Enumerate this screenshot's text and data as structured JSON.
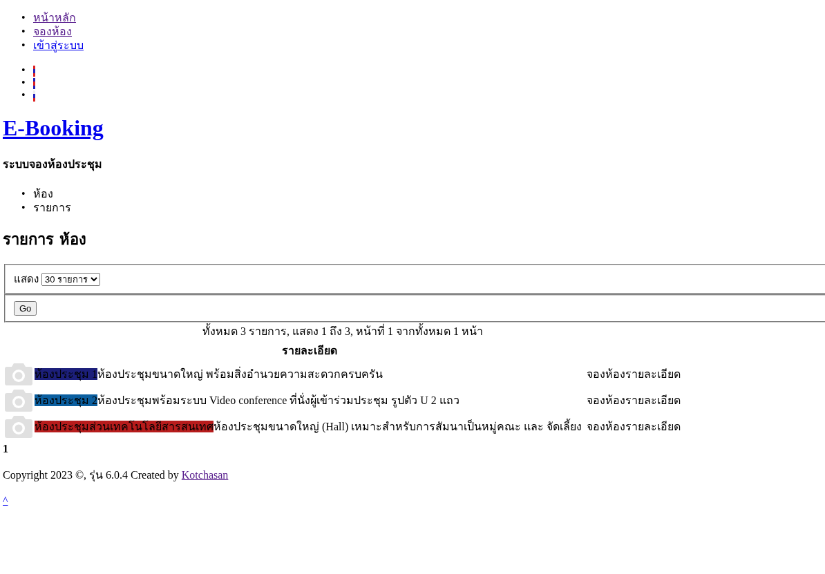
{
  "top_menu": [
    {
      "bullet": "•",
      "label": "หน้าหลัก",
      "visited": true
    },
    {
      "bullet": "•",
      "label": "จองห้อง",
      "visited": true
    },
    {
      "bullet": "•",
      "label": "เข้าสู่ระบบ",
      "visited": false
    }
  ],
  "languages": [
    {
      "bullet": "•"
    },
    {
      "bullet": "•"
    },
    {
      "bullet": "•"
    }
  ],
  "site": {
    "title": "E-Booking",
    "subtitle": "ระบบจองห้องประชุม"
  },
  "tabs": [
    {
      "bullet": "•",
      "label": "ห้อง"
    },
    {
      "bullet": "•",
      "label": "รายการ"
    }
  ],
  "heading": "รายการ ห้อง",
  "filter": {
    "label": "แสดง",
    "select_value": "30 รายการ",
    "button": "Go"
  },
  "table": {
    "caption": "ทั้งหมด 3 รายการ, แสดง 1 ถึง 3, หน้าที่ 1 จากทั้งหมด 1 หน้า",
    "columns": [
      "รายละเอียด"
    ],
    "rows": [
      {
        "name": "ห้องประชุม 1",
        "color": "#1c1f7a",
        "description": "ห้องประชุมขนาดใหญ่ พร้อมสิ่งอำนวยความสะดวกครบครัน",
        "book": "จองห้อง",
        "details": "รายละเอียด"
      },
      {
        "name": "ห้องประชุม 2",
        "color": "#0b5fa0",
        "description": "ห้องประชุมพร้อมระบบ Video conference ที่นั่งผู้เข้าร่วมประชุม รูปตัว U 2 แถว",
        "book": "จองห้อง",
        "details": "รายละเอียด"
      },
      {
        "name": "ห้องประชุมส่วนเทคโนโลยีสารสนเทศ",
        "color": "#b71c1c",
        "description": "ห้องประชุมขนาดใหญ่ (Hall) เหมาะสำหรับการสัมนาเป็นหมู่คณะ และ จัดเลี้ยง",
        "book": "จองห้อง",
        "details": "รายละเอียด"
      }
    ]
  },
  "pagination": {
    "current": "1"
  },
  "footer": {
    "text": "Copyright 2023 ©, รุ่น 6.0.4 Created by",
    "link": "Kotchasan"
  },
  "back_to_top": "^"
}
